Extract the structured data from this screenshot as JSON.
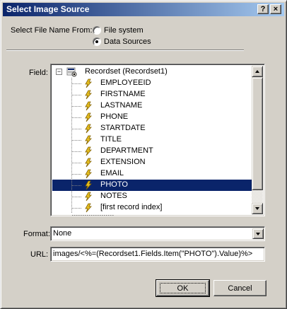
{
  "window": {
    "title": "Select Image Source",
    "help_button": "?",
    "close_button": "×"
  },
  "source": {
    "label": "Select File Name From:",
    "options": [
      {
        "label": "File system",
        "selected": false
      },
      {
        "label": "Data Sources",
        "selected": true
      }
    ]
  },
  "field": {
    "label": "Field:",
    "root": {
      "expander": "−",
      "label": "Recordset (Recordset1)"
    },
    "items": [
      {
        "label": "EMPLOYEEID",
        "selected": false
      },
      {
        "label": "FIRSTNAME",
        "selected": false
      },
      {
        "label": "LASTNAME",
        "selected": false
      },
      {
        "label": "PHONE",
        "selected": false
      },
      {
        "label": "STARTDATE",
        "selected": false
      },
      {
        "label": "TITLE",
        "selected": false
      },
      {
        "label": "DEPARTMENT",
        "selected": false
      },
      {
        "label": "EXTENSION",
        "selected": false
      },
      {
        "label": "EMAIL",
        "selected": false
      },
      {
        "label": "PHOTO",
        "selected": true
      },
      {
        "label": "NOTES",
        "selected": false
      },
      {
        "label": "[first record index]",
        "selected": false
      }
    ]
  },
  "format": {
    "label": "Format:",
    "value": "None"
  },
  "url": {
    "label": "URL:",
    "value": "images/<%=(Recordset1.Fields.Item(\"PHOTO\").Value)%>"
  },
  "buttons": {
    "ok": "OK",
    "cancel": "Cancel"
  },
  "colors": {
    "selection": "#0a246a",
    "face": "#d4d0c8",
    "title_start": "#0a246a",
    "title_end": "#a6caf0"
  }
}
